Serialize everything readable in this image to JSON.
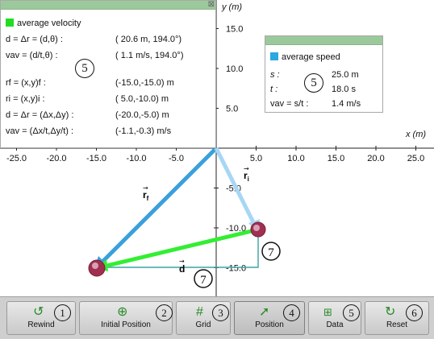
{
  "plot": {
    "x_title": "x (m)",
    "y_title": "y (m)",
    "x_ticks": [
      "-25.0",
      "-20.0",
      "-15.0",
      "-10.0",
      "-5.0",
      "5.0",
      "10.0",
      "15.0",
      "20.0",
      "25.0"
    ],
    "y_ticks": [
      "15.0",
      "10.0",
      "5.0",
      "-5.0",
      "-10.0",
      "-15.0"
    ],
    "vector_labels": {
      "rf": "r",
      "rf_sub": "f",
      "ri": "r",
      "ri_sub": "i",
      "d": "d"
    },
    "initial_position": [
      5.0,
      -10.0
    ],
    "final_position": [
      -15.0,
      -15.0
    ],
    "markers": [
      "7",
      "7"
    ],
    "colors": {
      "rf": "#3aa0dd",
      "ri": "#a8d6f5",
      "d": "#33ee33",
      "dx_dy": "#3aa3a3"
    }
  },
  "velocity_panel": {
    "legend": "average velocity",
    "legend_color": "#22dd22",
    "rows": [
      {
        "label": "d = Δr = (d,θ) :",
        "value": "( 20.6 m, 194.0°)"
      },
      {
        "label": "vav = (d/t,θ) :",
        "value": "( 1.1 m/s, 194.0°)"
      },
      {
        "label": "rf = (x,y)f :",
        "value": "(-15.0,-15.0) m"
      },
      {
        "label": "ri = (x,y)i :",
        "value": "( 5.0,-10.0) m"
      },
      {
        "label": "d = Δr = (Δx,Δy) :",
        "value": "(-20.0,-5.0) m"
      },
      {
        "label": "vav = (Δx/t,Δy/t) :",
        "value": "(-1.1,-0.3) m/s"
      }
    ],
    "marker": "5"
  },
  "speed_panel": {
    "legend": "average speed",
    "legend_color": "#2aa8e0",
    "rows": [
      {
        "label": "s :",
        "value": "25.0 m"
      },
      {
        "label": "t :",
        "value": "18.0 s"
      },
      {
        "label": "vav = s/t :",
        "value": "1.4 m/s"
      }
    ],
    "marker": "5"
  },
  "toolbar": [
    {
      "label": "Rewind",
      "num": "1",
      "icon": "rewind-icon"
    },
    {
      "label": "Initial Position",
      "num": "2",
      "icon": "crosshair-icon"
    },
    {
      "label": "Grid",
      "num": "3",
      "icon": "grid-icon"
    },
    {
      "label": "Position",
      "num": "4",
      "icon": "arrow-icon"
    },
    {
      "label": "Data",
      "num": "5",
      "icon": "data-icon"
    },
    {
      "label": "Reset",
      "num": "6",
      "icon": "reset-icon"
    }
  ]
}
